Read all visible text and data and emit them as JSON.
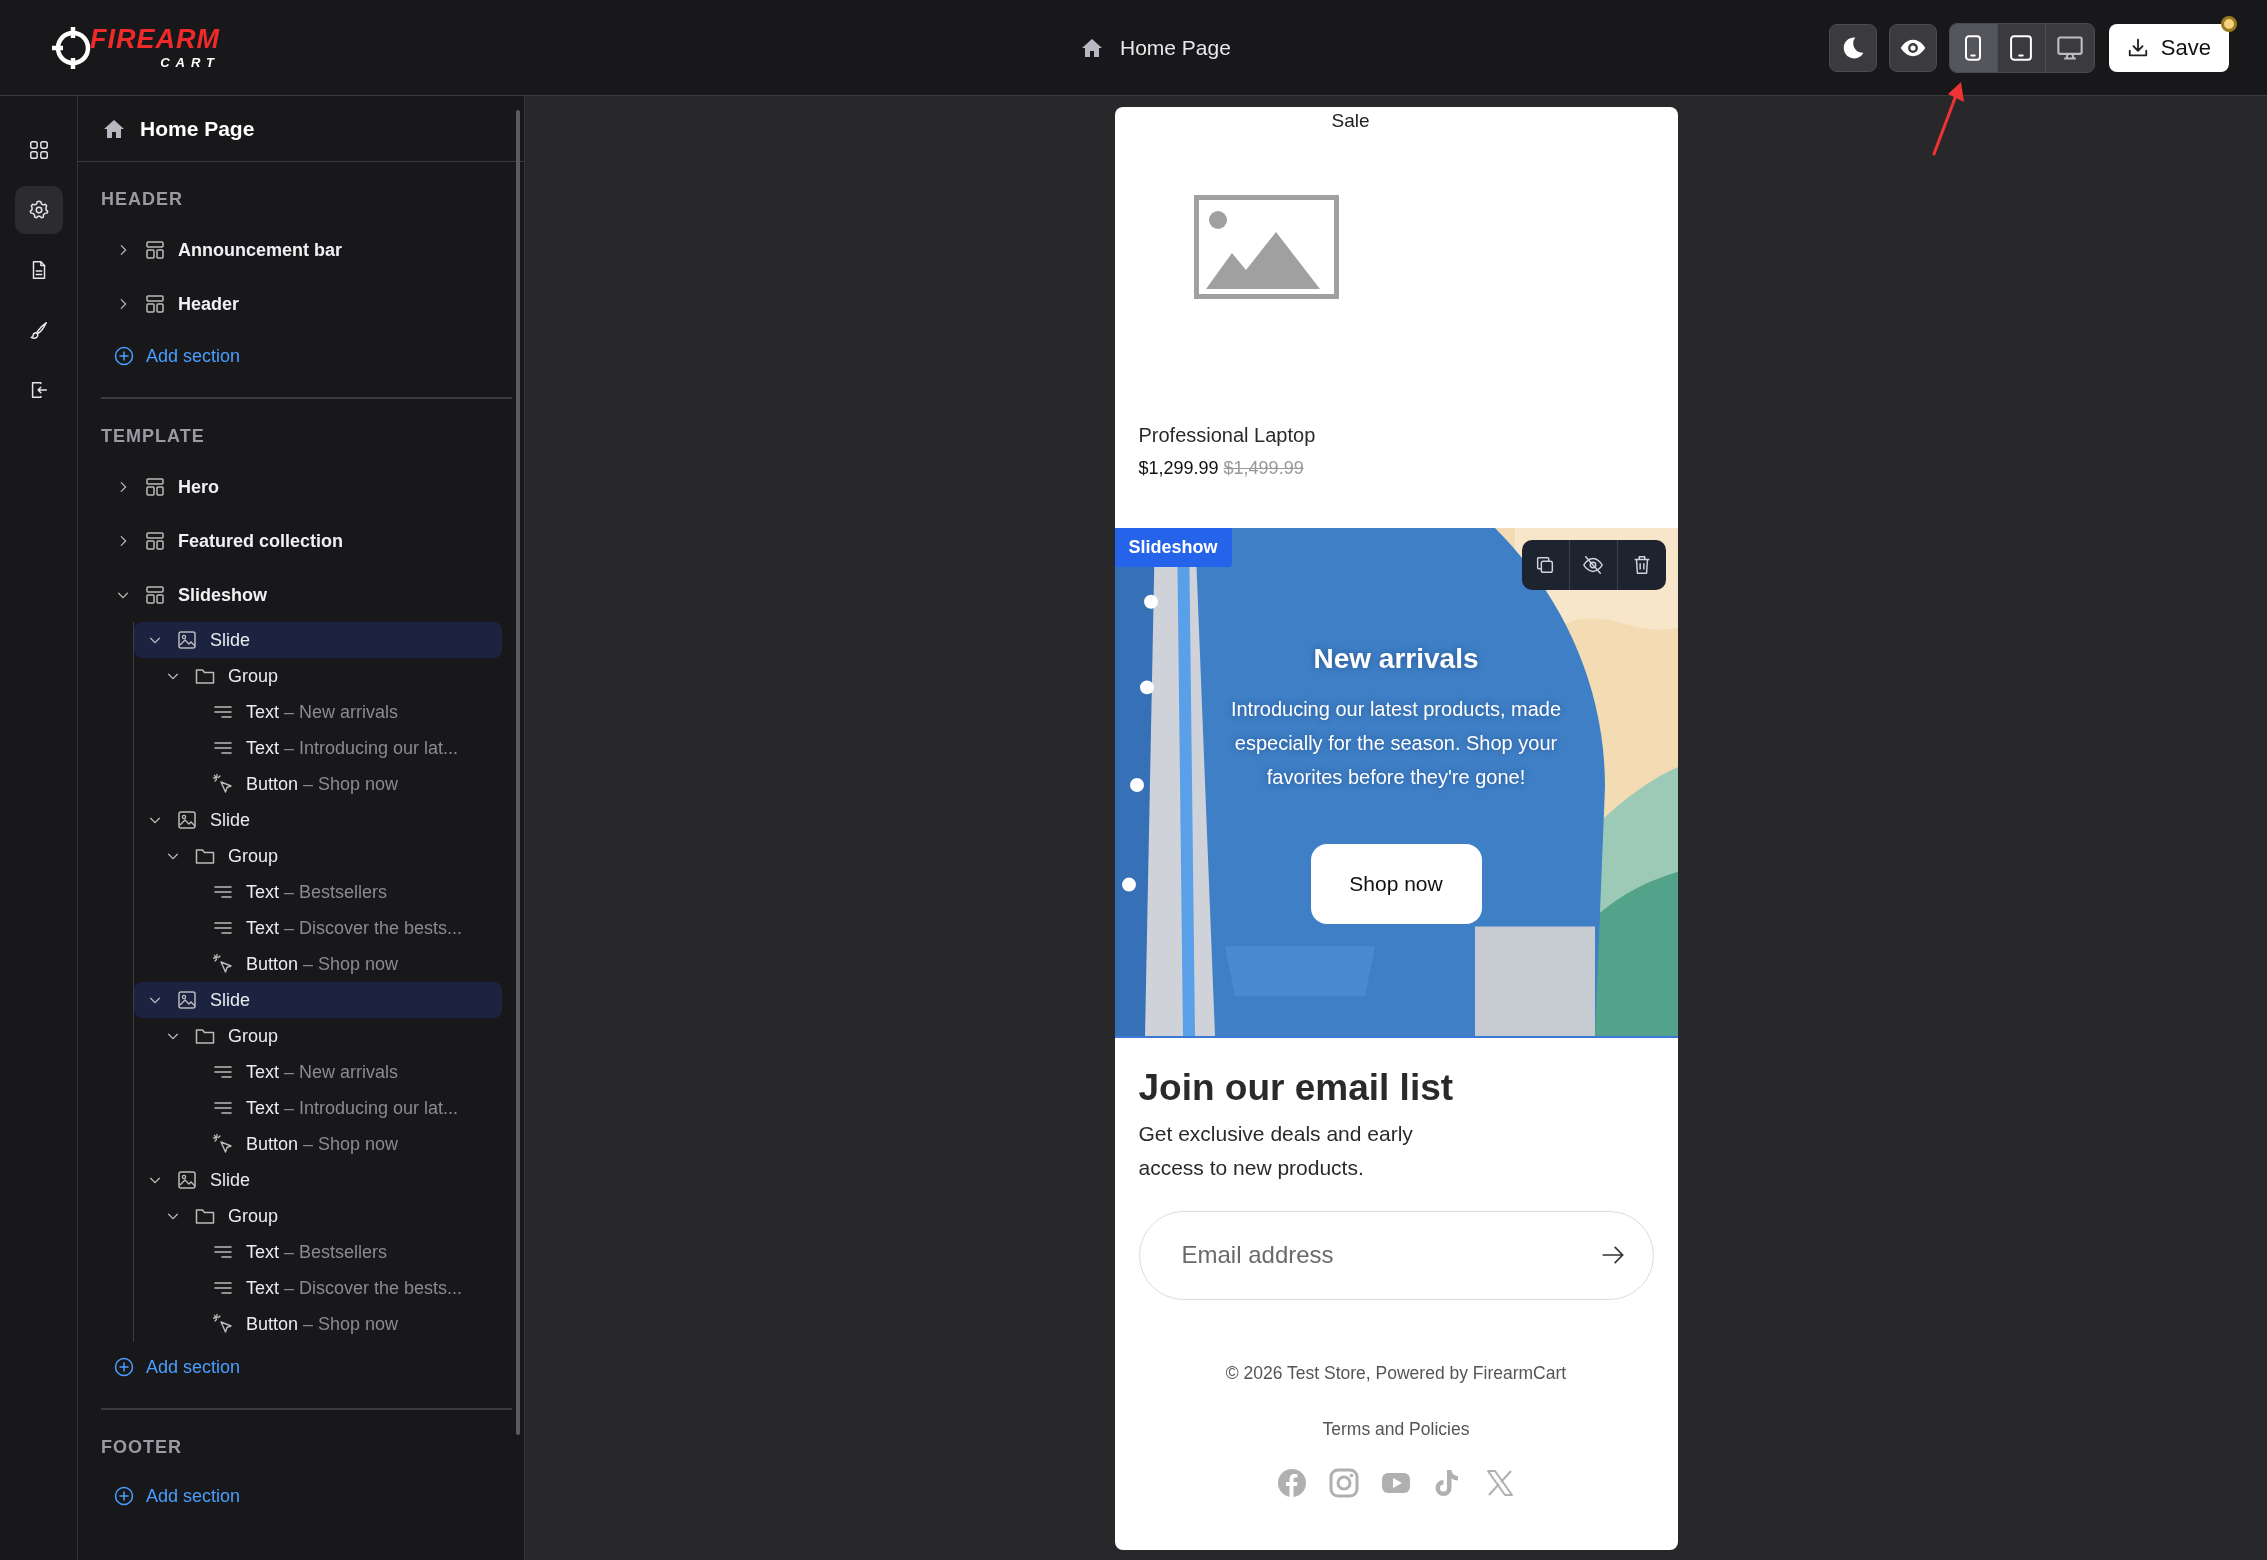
{
  "logo": {
    "main": "FIREARM",
    "sub": "CART"
  },
  "topbar": {
    "page_title": "Home Page",
    "theme_toggle": {
      "kind": "dark"
    },
    "preview_toggle": {
      "kind": "eye"
    },
    "view_modes": [
      {
        "kind": "mobile",
        "selected": true
      },
      {
        "kind": "tablet",
        "selected": false
      },
      {
        "kind": "desktop",
        "selected": false
      }
    ],
    "save_label": "Save",
    "unsaved_changes": true
  },
  "rail": [
    {
      "kind": "apps",
      "selected": false
    },
    {
      "kind": "settings",
      "selected": true
    },
    {
      "kind": "pages",
      "selected": false
    },
    {
      "kind": "theme",
      "selected": false
    },
    {
      "kind": "exit",
      "selected": false
    }
  ],
  "sidebar": {
    "title": "Home Page",
    "groups": [
      {
        "heading": "HEADER",
        "items": [
          {
            "kind": "section",
            "label": "Announcement bar",
            "expanded": false,
            "selected": false
          },
          {
            "kind": "section",
            "label": "Header",
            "expanded": false,
            "selected": false
          }
        ],
        "add_label": "Add section"
      },
      {
        "heading": "TEMPLATE",
        "items": [
          {
            "kind": "section",
            "label": "Hero",
            "expanded": false,
            "selected": false
          },
          {
            "kind": "section",
            "label": "Featured collection",
            "expanded": false,
            "selected": false
          },
          {
            "kind": "section",
            "label": "Slideshow",
            "expanded": true,
            "selected": false,
            "children": [
              {
                "kind": "slide",
                "label": "Slide",
                "expanded": true,
                "selected": true,
                "children": [
                  {
                    "kind": "group",
                    "label": "Group",
                    "expanded": true,
                    "selected": false,
                    "children": [
                      {
                        "kind": "text",
                        "label": "Text",
                        "detail": "– New arrivals",
                        "selected": false
                      },
                      {
                        "kind": "text",
                        "label": "Text",
                        "detail": "– Introducing our lat...",
                        "selected": false
                      },
                      {
                        "kind": "button",
                        "label": "Button",
                        "detail": "– Shop now",
                        "selected": false
                      }
                    ]
                  }
                ]
              },
              {
                "kind": "slide",
                "label": "Slide",
                "expanded": true,
                "selected": false,
                "children": [
                  {
                    "kind": "group",
                    "label": "Group",
                    "expanded": true,
                    "selected": false,
                    "children": [
                      {
                        "kind": "text",
                        "label": "Text",
                        "detail": "– Bestsellers",
                        "selected": false
                      },
                      {
                        "kind": "text",
                        "label": "Text",
                        "detail": "– Discover the bests...",
                        "selected": false
                      },
                      {
                        "kind": "button",
                        "label": "Button",
                        "detail": "– Shop now",
                        "selected": false
                      }
                    ]
                  }
                ]
              },
              {
                "kind": "slide",
                "label": "Slide",
                "expanded": true,
                "selected": true,
                "children": [
                  {
                    "kind": "group",
                    "label": "Group",
                    "expanded": true,
                    "selected": false,
                    "children": [
                      {
                        "kind": "text",
                        "label": "Text",
                        "detail": "– New arrivals",
                        "selected": false
                      },
                      {
                        "kind": "text",
                        "label": "Text",
                        "detail": "– Introducing our lat...",
                        "selected": false
                      },
                      {
                        "kind": "button",
                        "label": "Button",
                        "detail": "– Shop now",
                        "selected": false
                      }
                    ]
                  }
                ]
              },
              {
                "kind": "slide",
                "label": "Slide",
                "expanded": true,
                "selected": false,
                "children": [
                  {
                    "kind": "group",
                    "label": "Group",
                    "expanded": true,
                    "selected": false,
                    "children": [
                      {
                        "kind": "text",
                        "label": "Text",
                        "detail": "– Bestsellers",
                        "selected": false
                      },
                      {
                        "kind": "text",
                        "label": "Text",
                        "detail": "– Discover the bests...",
                        "selected": false
                      },
                      {
                        "kind": "button",
                        "label": "Button",
                        "detail": "– Shop now",
                        "selected": false
                      }
                    ]
                  }
                ]
              }
            ]
          }
        ],
        "add_label": "Add section"
      },
      {
        "heading": "FOOTER",
        "add_label": "Add section"
      }
    ]
  },
  "preview": {
    "product": {
      "badge": "Sale",
      "name": "Professional Laptop",
      "price": "$1,299.99",
      "compare_price": "$1,499.99"
    },
    "slideshow": {
      "tag": "Slideshow",
      "tools": [
        {
          "kind": "duplicate"
        },
        {
          "kind": "hide"
        },
        {
          "kind": "delete"
        }
      ],
      "heading": "New arrivals",
      "text": "Introducing our latest products, made especially for the season. Shop your favorites before they're gone!",
      "button": "Shop now"
    },
    "newsletter": {
      "heading": "Join our email list",
      "text": "Get exclusive deals and early access to new products.",
      "placeholder": "Email address"
    },
    "footer": {
      "copyright": "© 2026 Test Store, Powered by FirearmCart",
      "link": "Terms and Policies",
      "socials": [
        {
          "kind": "facebook"
        },
        {
          "kind": "instagram"
        },
        {
          "kind": "youtube"
        },
        {
          "kind": "tiktok"
        },
        {
          "kind": "x"
        }
      ]
    }
  }
}
